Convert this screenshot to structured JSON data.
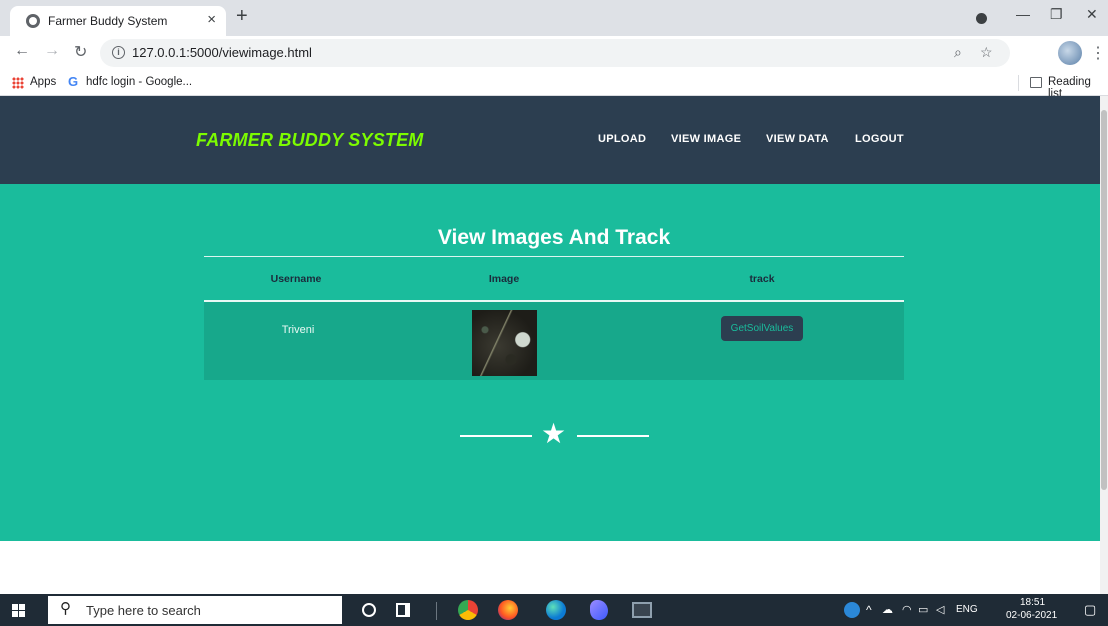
{
  "browser": {
    "tab_title": "Farmer Buddy System",
    "tab_close": "×",
    "new_tab": "+",
    "url": "127.0.0.1:5000/viewimage.html",
    "bookmarks": [
      {
        "label": "Apps"
      },
      {
        "label": "hdfc login - Google..."
      }
    ],
    "reading_list": "Reading list"
  },
  "site": {
    "brand": "FARMER BUDDY SYSTEM",
    "nav": [
      "UPLOAD",
      "VIEW IMAGE",
      "VIEW DATA",
      "LOGOUT"
    ]
  },
  "section": {
    "title": "View Images And Track",
    "columns": [
      "Username",
      "Image",
      "track"
    ],
    "rows": [
      {
        "username": "Triveni",
        "button": "GetSoilValues"
      }
    ]
  },
  "taskbar": {
    "search_placeholder": "Type here to search",
    "lang": "ENG",
    "time": "18:51",
    "date": "02-06-2021"
  },
  "colors": {
    "nav_bg": "#2c3e50",
    "brand": "#7cfc00",
    "teal": "#1abc9c"
  }
}
